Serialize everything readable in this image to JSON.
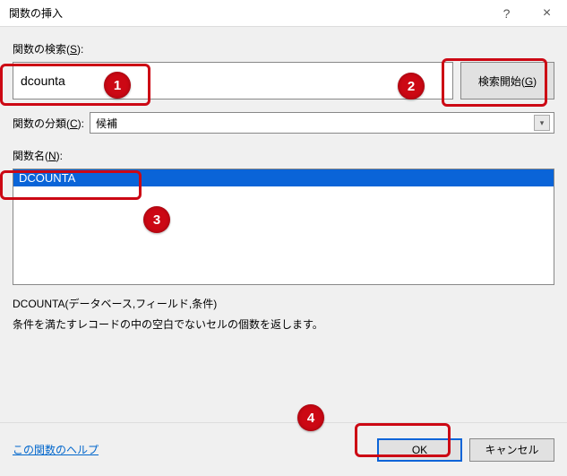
{
  "title": "関数の挿入",
  "titlebar": {
    "help": "?",
    "close": "×"
  },
  "search": {
    "label_pre": "関数の検索(",
    "label_hot": "S",
    "label_post": "):",
    "value": "dcounta",
    "button_pre": "検索開始(",
    "button_hot": "G",
    "button_post": ")"
  },
  "category": {
    "label_pre": "関数の分類(",
    "label_hot": "C",
    "label_post": "):",
    "selected": "候補"
  },
  "namelabel": {
    "pre": "関数名(",
    "hot": "N",
    "post": "):"
  },
  "list": {
    "items": [
      "DCOUNTA"
    ]
  },
  "description": {
    "signature": "DCOUNTA(データベース,フィールド,条件)",
    "text": "条件を満たすレコードの中の空白でないセルの個数を返します。"
  },
  "footer": {
    "help_link": "この関数のヘルプ",
    "ok": "OK",
    "cancel": "キャンセル"
  },
  "callouts": {
    "n1": "1",
    "n2": "2",
    "n3": "3",
    "n4": "4"
  }
}
